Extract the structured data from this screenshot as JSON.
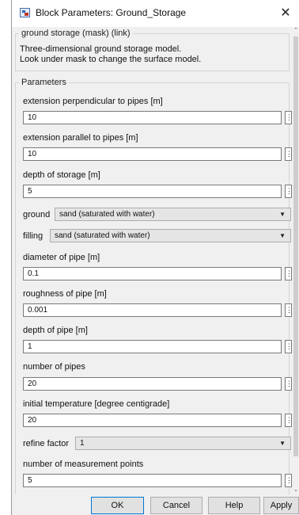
{
  "window": {
    "title": "Block Parameters: Ground_Storage",
    "close_glyph": "✕"
  },
  "mask": {
    "header": "ground storage (mask) (link)",
    "description_line1": "Three-dimensional ground storage model.",
    "description_line2": "Look under mask to change the surface model."
  },
  "parameters": {
    "group_title": "Parameters",
    "extension_perpendicular": {
      "label": "extension perpendicular to pipes [m]",
      "value": "10"
    },
    "extension_parallel": {
      "label": "extension parallel to pipes [m]",
      "value": "10"
    },
    "depth_of_storage": {
      "label": "depth of storage [m]",
      "value": "5"
    },
    "ground": {
      "label": "ground",
      "value": "sand (saturated with water)"
    },
    "filling": {
      "label": "filling",
      "value": "sand (saturated with water)"
    },
    "diameter_of_pipe": {
      "label": "diameter of pipe [m]",
      "value": "0.1"
    },
    "roughness_of_pipe": {
      "label": "roughness of pipe [m]",
      "value": "0.001"
    },
    "depth_of_pipe": {
      "label": "depth of pipe [m]",
      "value": "1"
    },
    "number_of_pipes": {
      "label": "number of pipes",
      "value": "20"
    },
    "initial_temperature": {
      "label": "initial temperature [degree centigrade]",
      "value": "20"
    },
    "refine_factor": {
      "label": "refine factor",
      "value": "1"
    },
    "measurement_points": {
      "label": "number of measurement points",
      "value": "5"
    }
  },
  "glyphs": {
    "dots": "⋮",
    "dropdown": "▼",
    "scroll_up": "⌃",
    "scroll_down": "⌄"
  },
  "buttons": {
    "ok": "OK",
    "cancel": "Cancel",
    "help": "Help",
    "apply": "Apply"
  },
  "colors": {
    "dialog_bg": "#f0f0f0",
    "default_button_border": "#0078d7"
  }
}
